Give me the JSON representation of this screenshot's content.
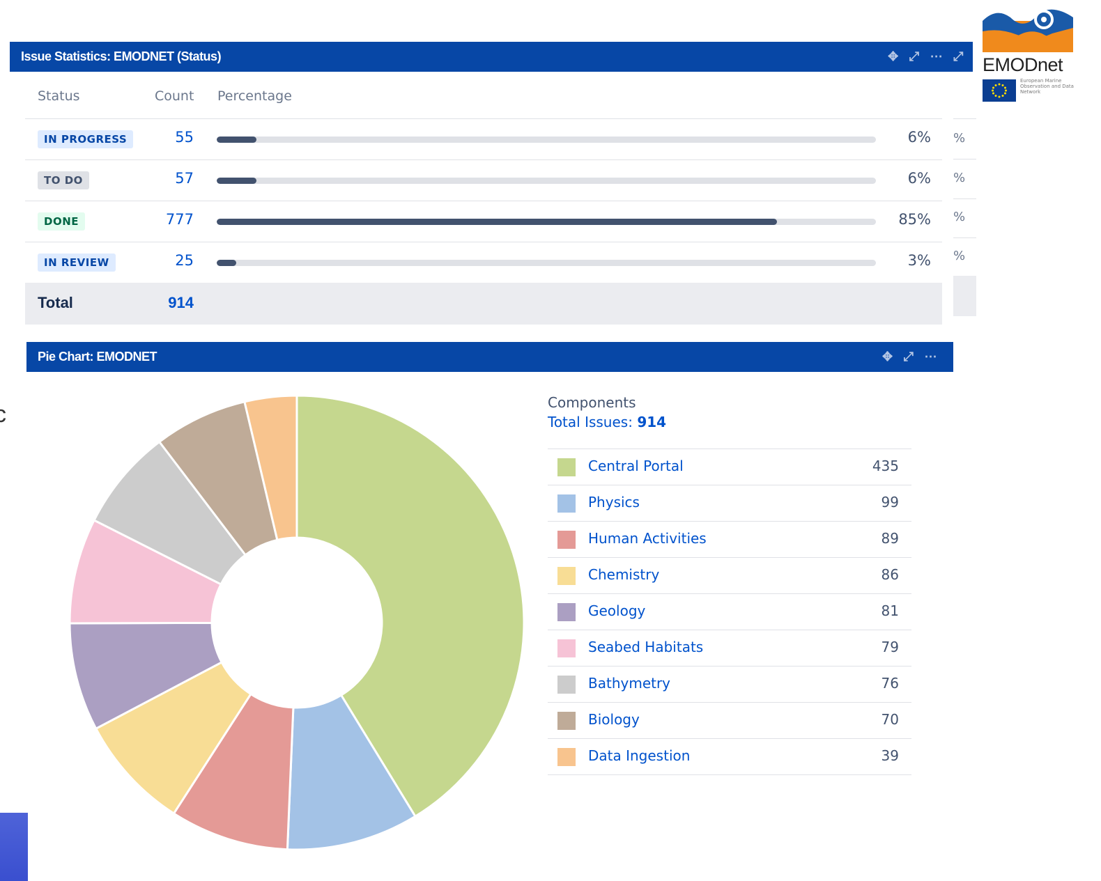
{
  "stats_gadget": {
    "title": "Issue Statistics: EMODNET (Status)",
    "icons": [
      "move-icon",
      "resize-icon",
      "more-icon",
      "expand-icon"
    ],
    "columns": {
      "status": "Status",
      "count": "Count",
      "percentage": "Percentage"
    },
    "rows": [
      {
        "status": "IN PROGRESS",
        "count": "55",
        "percent_label": "6%",
        "percent": 6
      },
      {
        "status": "TO DO",
        "count": "57",
        "percent_label": "6%",
        "percent": 6
      },
      {
        "status": "DONE",
        "count": "777",
        "percent_label": "85%",
        "percent": 85
      },
      {
        "status": "IN REVIEW",
        "count": "25",
        "percent_label": "3%",
        "percent": 3
      }
    ],
    "total_label": "Total",
    "total_count": "914",
    "edge_percent": "%"
  },
  "logo": {
    "name": "EMODnet",
    "tagline": "European Marine Observation and Data Network"
  },
  "pie_gadget": {
    "title": "Pie Chart: EMODNET",
    "icons": [
      "move-icon",
      "resize-icon",
      "more-icon"
    ],
    "legend_title": "Components",
    "total_prefix": "Total Issues:",
    "total_value": "914"
  },
  "side_letter": "c",
  "chart_data": {
    "type": "pie",
    "title": "Components",
    "total": 914,
    "categories": [
      "Central Portal",
      "Physics",
      "Human Activities",
      "Chemistry",
      "Geology",
      "Seabed Habitats",
      "Bathymetry",
      "Biology",
      "Data Ingestion"
    ],
    "values": [
      435,
      99,
      89,
      86,
      81,
      79,
      76,
      70,
      39
    ],
    "colors": [
      "#c5d78e",
      "#a3c2e6",
      "#e49a96",
      "#f8dd95",
      "#ab9fc2",
      "#f6c3d6",
      "#cccccc",
      "#bfab98",
      "#f8c48e"
    ],
    "donut": true
  }
}
